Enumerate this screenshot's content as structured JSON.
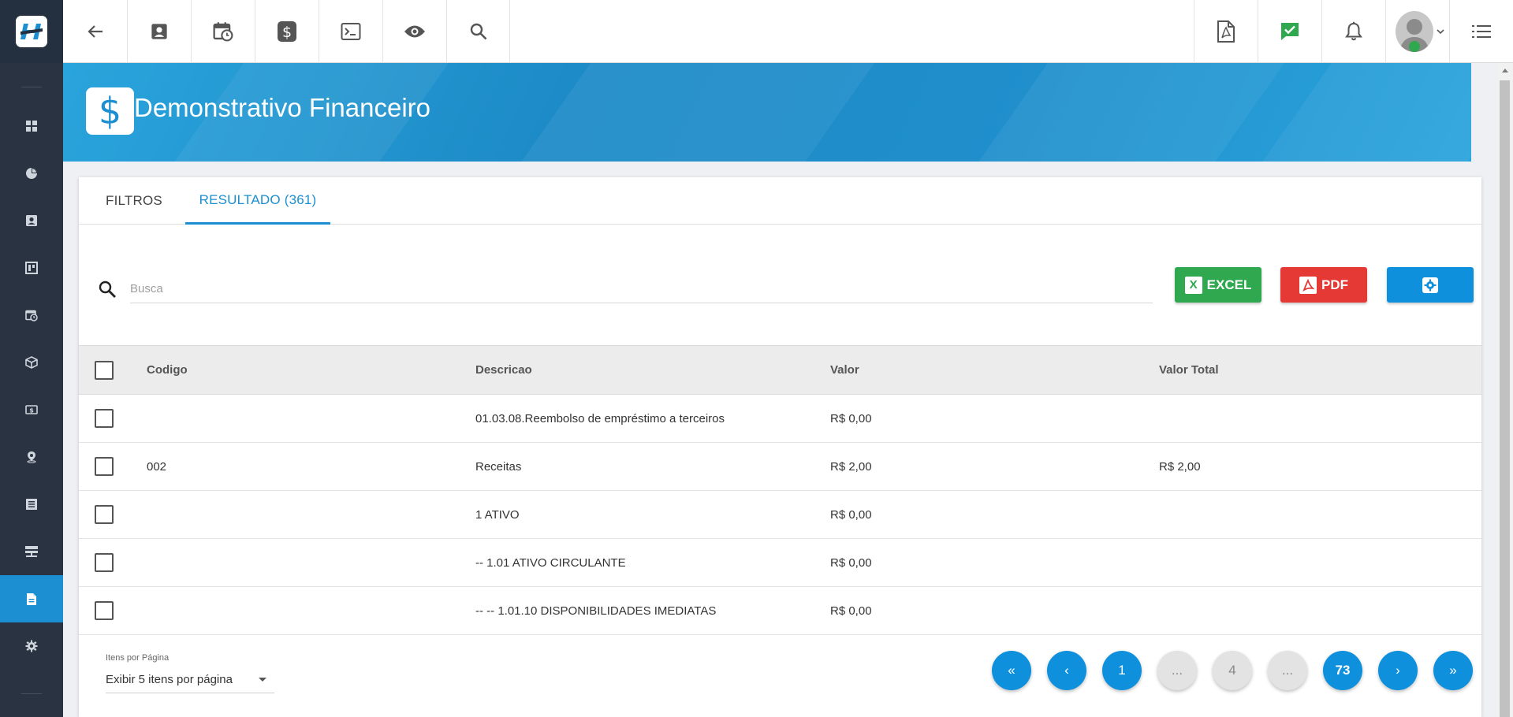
{
  "page_title": "Demonstrativo Financeiro",
  "banner_icon_symbol": "$",
  "sidebar": {
    "items": [
      {
        "icon": "dashboard-icon"
      },
      {
        "icon": "pie-chart-icon"
      },
      {
        "icon": "contact-card-icon"
      },
      {
        "icon": "kanban-icon"
      },
      {
        "icon": "calendar-clock-icon"
      },
      {
        "icon": "box-icon"
      },
      {
        "icon": "money-icon"
      },
      {
        "icon": "location-pin-icon"
      },
      {
        "icon": "document-list-icon"
      },
      {
        "icon": "server-icon"
      },
      {
        "icon": "file-report-icon",
        "active": true
      },
      {
        "icon": "gear-icon"
      }
    ]
  },
  "topbar": {
    "left_icons": [
      "back-arrow-icon",
      "contact-card-icon",
      "calendar-clock-icon",
      "dollar-icon",
      "terminal-icon",
      "eye-icon",
      "search-icon"
    ],
    "right_icons": [
      "pdf-file-icon",
      "chat-check-icon",
      "bell-icon",
      "user-avatar",
      "list-menu-icon"
    ]
  },
  "tabs": [
    {
      "label": "FILTROS",
      "active": false
    },
    {
      "label": "RESULTADO (361)",
      "active": true
    }
  ],
  "search": {
    "placeholder": "Busca",
    "value": ""
  },
  "actions": {
    "excel_label": "EXCEL",
    "excel_badge": "X",
    "pdf_label": "PDF"
  },
  "table": {
    "headers": {
      "code": "Codigo",
      "description": "Descricao",
      "value": "Valor",
      "total": "Valor Total"
    },
    "rows": [
      {
        "code": "",
        "description": "01.03.08.Reembolso de empréstimo a terceiros",
        "value": "R$ 0,00",
        "total": ""
      },
      {
        "code": "002",
        "description": "Receitas",
        "value": "R$ 2,00",
        "total": "R$ 2,00"
      },
      {
        "code": "",
        "description": "1 ATIVO",
        "value": "R$ 0,00",
        "total": ""
      },
      {
        "code": "",
        "description": "-- 1.01 ATIVO CIRCULANTE",
        "value": "R$ 0,00",
        "total": ""
      },
      {
        "code": "",
        "description": "-- -- 1.01.10 DISPONIBILIDADES IMEDIATAS",
        "value": "R$ 0,00",
        "total": ""
      }
    ]
  },
  "pagination": {
    "items_label": "Itens por Página",
    "items_value": "Exibir 5 itens por página",
    "first": "«",
    "prev": "‹",
    "page_1": "1",
    "ellipsis_1": "...",
    "page_4": "4",
    "ellipsis_2": "...",
    "page_last": "73",
    "next": "›",
    "last": "»"
  },
  "colors": {
    "primary": "#1b8fd2",
    "sidebar": "#2a3341",
    "excel": "#2fa84f",
    "pdf": "#e53935",
    "chat_check": "#2fa84f"
  }
}
